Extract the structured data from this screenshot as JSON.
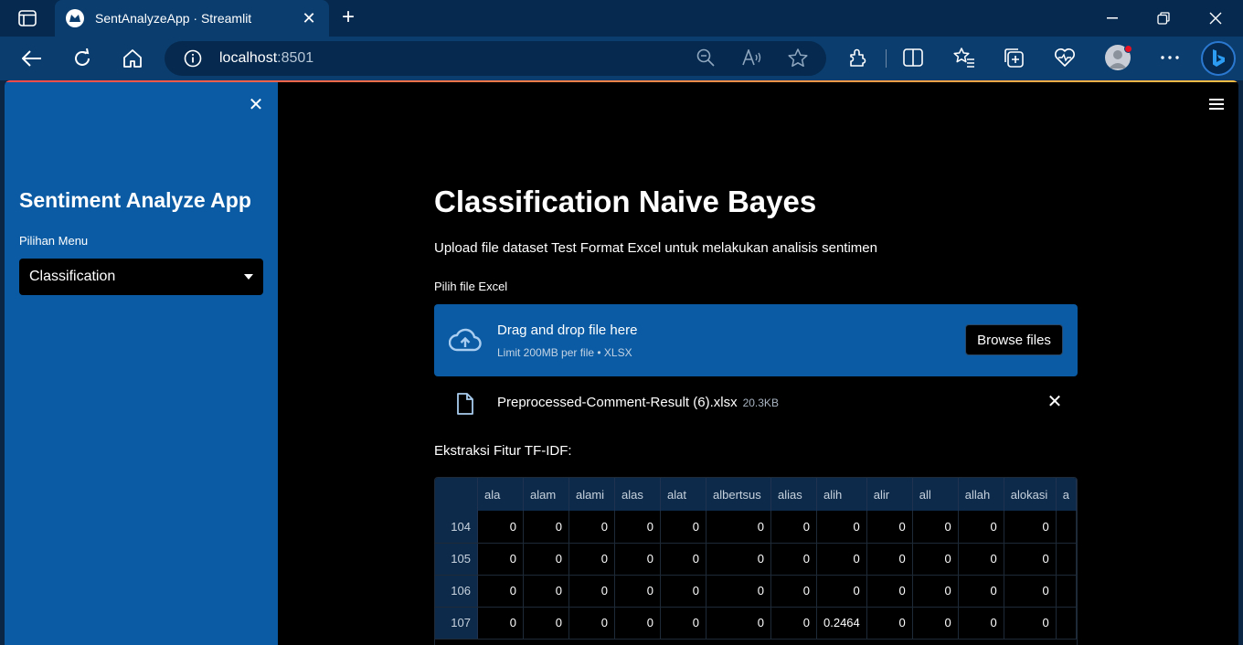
{
  "browser": {
    "tab_title": "SentAnalyzeApp · Streamlit",
    "url_host": "localhost",
    "url_port": ":8501"
  },
  "sidebar": {
    "app_title": "Sentiment Analyze App",
    "menu_label": "Pilihan Menu",
    "menu_value": "Classification"
  },
  "main": {
    "title": "Classification Naive Bayes",
    "subtitle": "Upload file dataset Test Format Excel untuk melakukan analisis sentimen",
    "uploader_label": "Pilih file Excel",
    "dropzone_main": "Drag and drop file here",
    "dropzone_sub": "Limit 200MB per file • XLSX",
    "browse_label": "Browse files",
    "file_name": "Preprocessed-Comment-Result (6).xlsx",
    "file_size": "20.3KB",
    "section_label": "Ekstraksi Fitur TF-IDF:"
  },
  "table": {
    "columns": [
      "ala",
      "alam",
      "alami",
      "alas",
      "alat",
      "albertsus",
      "alias",
      "alih",
      "alir",
      "all",
      "allah",
      "alokasi",
      "a"
    ],
    "rows": [
      {
        "index": "104",
        "values": [
          "0",
          "0",
          "0",
          "0",
          "0",
          "0",
          "0",
          "0",
          "0",
          "0",
          "0",
          "0",
          ""
        ]
      },
      {
        "index": "105",
        "values": [
          "0",
          "0",
          "0",
          "0",
          "0",
          "0",
          "0",
          "0",
          "0",
          "0",
          "0",
          "0",
          ""
        ]
      },
      {
        "index": "106",
        "values": [
          "0",
          "0",
          "0",
          "0",
          "0",
          "0",
          "0",
          "0",
          "0",
          "0",
          "0",
          "0",
          ""
        ]
      },
      {
        "index": "107",
        "values": [
          "0",
          "0",
          "0",
          "0",
          "0",
          "0",
          "0",
          "0.2464",
          "0",
          "0",
          "0",
          "0",
          ""
        ]
      }
    ]
  }
}
